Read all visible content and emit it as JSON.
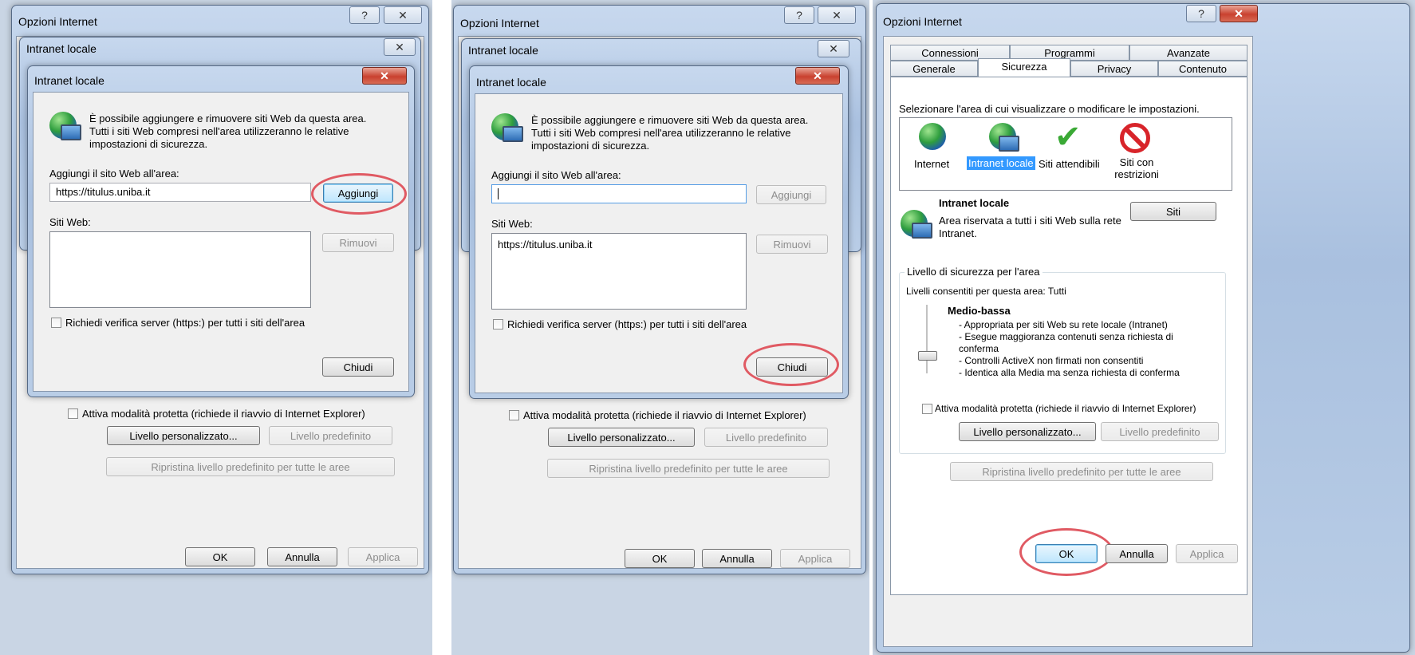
{
  "colors": {
    "highlight_circle": "#e05a63",
    "selection_blue": "#3399ff"
  },
  "panel1": {
    "outer_title": "Opzioni Internet",
    "mid_title": "Intranet locale",
    "dialog_title": "Intranet locale",
    "description": "È possibile aggiungere e rimuovere siti Web da questa area.\nTutti i siti Web compresi nell'area utilizzeranno le relative\nimpostazioni di sicurezza.",
    "add_label": "Aggiungi il sito Web all'area:",
    "add_value": "https://titulus.uniba.it",
    "add_button": "Aggiungi",
    "sites_label": "Siti Web:",
    "remove_button": "Rimuovi",
    "https_check": "Richiedi verifica server (https:) per tutti i siti dell'area",
    "close_button": "Chiudi",
    "protected_mode": "Attiva modalità protetta (richiede il riavvio di Internet Explorer)",
    "custom_level": "Livello personalizzato...",
    "default_level": "Livello predefinito",
    "reset_all": "Ripristina livello predefinito per tutte le aree",
    "ok": "OK",
    "cancel": "Annulla",
    "apply": "Applica"
  },
  "panel2": {
    "outer_title": "Opzioni Internet",
    "mid_title": "Intranet locale",
    "dialog_title": "Intranet locale",
    "description": "È possibile aggiungere e rimuovere siti Web da questa area.\nTutti i siti Web compresi nell'area utilizzeranno le relative\nimpostazioni di sicurezza.",
    "add_label": "Aggiungi il sito Web all'area:",
    "add_button": "Aggiungi",
    "sites_label": "Siti Web:",
    "site_entry": "https://titulus.uniba.it",
    "remove_button": "Rimuovi",
    "https_check": "Richiedi verifica server (https:) per tutti i siti dell'area",
    "close_button": "Chiudi",
    "protected_mode": "Attiva modalità protetta (richiede il riavvio di Internet Explorer)",
    "custom_level": "Livello personalizzato...",
    "default_level": "Livello predefinito",
    "reset_all": "Ripristina livello predefinito per tutte le aree",
    "ok": "OK",
    "cancel": "Annulla",
    "apply": "Applica"
  },
  "panel3": {
    "title": "Opzioni Internet",
    "tabs_back": [
      "Connessioni",
      "Programmi",
      "Avanzate"
    ],
    "tabs_front": [
      "Generale",
      "Sicurezza",
      "Privacy",
      "Contenuto"
    ],
    "zone_prompt": "Selezionare l'area di cui visualizzare o modificare le impostazioni.",
    "zones": [
      "Internet",
      "Intranet locale",
      "Siti attendibili",
      "Siti con restrizioni"
    ],
    "zone_name": "Intranet locale",
    "zone_desc": "Area riservata a tutti i siti Web sulla rete\nIntranet.",
    "sites_button": "Siti",
    "level_group": "Livello di sicurezza per l'area",
    "allowed_levels": "Livelli consentiti per questa area: Tutti",
    "level_name": "Medio-bassa",
    "level_desc": "- Appropriata per siti Web su rete locale (Intranet)\n- Esegue maggioranza contenuti senza richiesta di\nconferma\n- Controlli ActiveX non firmati non consentiti\n- Identica alla Media ma senza richiesta di conferma",
    "protected_mode": "Attiva modalità protetta (richiede il riavvio di Internet Explorer)",
    "custom_level": "Livello personalizzato...",
    "default_level": "Livello predefinito",
    "reset_all": "Ripristina livello predefinito per tutte le aree",
    "ok": "OK",
    "cancel": "Annulla",
    "apply": "Applica"
  }
}
